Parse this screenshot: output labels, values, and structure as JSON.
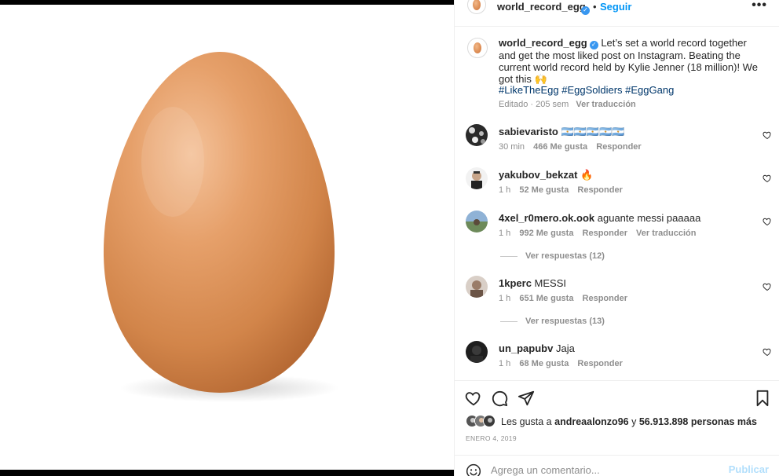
{
  "post": {
    "username": "world_record_egg",
    "follow_label": "Seguir",
    "separator": "•",
    "more_label": "•••"
  },
  "caption": {
    "username": "world_record_egg",
    "text": "Let’s set a world record together and get the most liked post on Instagram. Beating the current world record held by Kylie Jenner (18 million)! We got this 🙌",
    "hashtags": "#LikeTheEgg #EggSoldiers #EggGang",
    "edited": "Editado · 205 sem",
    "translate": "Ver traducción"
  },
  "comments": [
    {
      "username": "sabievaristo",
      "text": "🇦🇷🇦🇷🇦🇷🇦🇷🇦🇷",
      "time": "30 min",
      "likes": "466 Me gusta",
      "reply": "Responder",
      "avatar_color": "#2a2a2a"
    },
    {
      "username": "yakubov_bekzat",
      "text": "🔥",
      "time": "1 h",
      "likes": "52 Me gusta",
      "reply": "Responder",
      "avatar_color": "#4a4a4a"
    },
    {
      "username": "4xel_r0mero.ok.ook",
      "text": "aguante messi paaaaa",
      "time": "1 h",
      "likes": "992 Me gusta",
      "reply": "Responder",
      "translate": "Ver traducción",
      "avatar_color": "#6d8a5a",
      "replies": "Ver respuestas (12)"
    },
    {
      "username": "1kperc",
      "text": "MESSI",
      "time": "1 h",
      "likes": "651 Me gusta",
      "reply": "Responder",
      "avatar_color": "#9a7c68",
      "replies": "Ver respuestas (13)"
    },
    {
      "username": "un_papubv",
      "text": "Jaja",
      "time": "1 h",
      "likes": "68 Me gusta",
      "reply": "Responder",
      "avatar_color": "#1e1e1e"
    }
  ],
  "likes": {
    "prefix": "Les gusta a",
    "user": "andreaalonzo96",
    "connector": "y",
    "others": "56.913.898 personas más"
  },
  "date": "ENERO 4, 2019",
  "add_comment": {
    "placeholder": "Agrega un comentario...",
    "post_label": "Publicar"
  },
  "colors": {
    "link_blue": "#0095f6",
    "hashtag": "#00376b",
    "muted": "#8e8e8e",
    "post_disabled": "#b2dffc"
  },
  "icons": [
    "verified-badge-icon",
    "more-options-icon",
    "heart-icon",
    "comment-icon",
    "share-icon",
    "bookmark-icon",
    "emoji-icon"
  ]
}
